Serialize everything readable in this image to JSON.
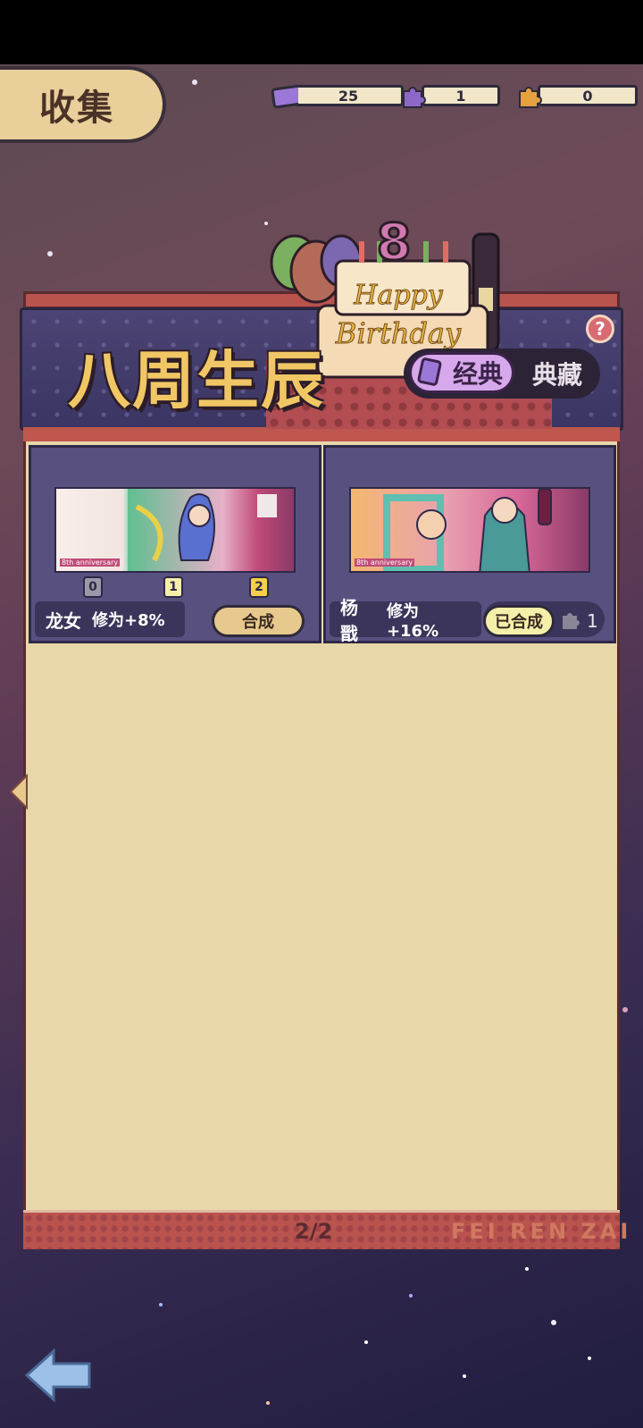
{
  "header": {
    "title": "收集"
  },
  "resources": [
    {
      "name": "ticket",
      "icon": "ticket-icon",
      "value": "25",
      "color": "#9b78d8"
    },
    {
      "name": "purple-puzzle",
      "icon": "puzzle-icon",
      "value": "1",
      "color": "#8d68c8"
    },
    {
      "name": "orange-puzzle",
      "icon": "puzzle-icon",
      "value": "0",
      "color": "#e5a040"
    }
  ],
  "banner": {
    "title": "八周生辰",
    "cake_text": "Happy Birthday",
    "cake_number": "8",
    "toggle": {
      "active": "经典",
      "inactive": "典藏"
    },
    "help": "?"
  },
  "cards": [
    {
      "name": "龙女",
      "bonus": "修为+8%",
      "action": "合成",
      "tags": [
        "0",
        "1",
        "2"
      ],
      "art_caption": "8th anniversary"
    },
    {
      "name": "杨戬",
      "bonus": "修为+16%",
      "action": "已合成",
      "count": "1",
      "art_caption": "8th anniversary"
    }
  ],
  "footer": {
    "page": "2/2",
    "brand": "FEI REN ZAI"
  },
  "colors": {
    "accent": "#f1c766",
    "panel": "#e7d7a9",
    "frame": "#b8534e"
  }
}
